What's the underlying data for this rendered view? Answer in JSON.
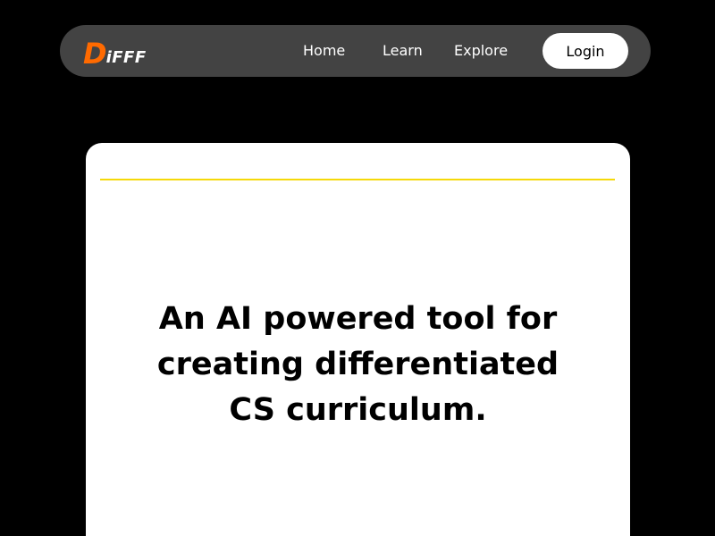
{
  "navbar": {
    "logo": {
      "first_letter": "D",
      "rest": "iFFF",
      "first_letter_color": "#ff6a00"
    },
    "links": {
      "home": "Home",
      "learn": "Learn",
      "explore": "Explore"
    },
    "login_label": "Login",
    "background_color": "#434343"
  },
  "hero": {
    "lines": [
      "An AI powered tool for",
      "creating differentiated",
      "CS curriculum."
    ],
    "accent_color": "#f5d90a"
  }
}
